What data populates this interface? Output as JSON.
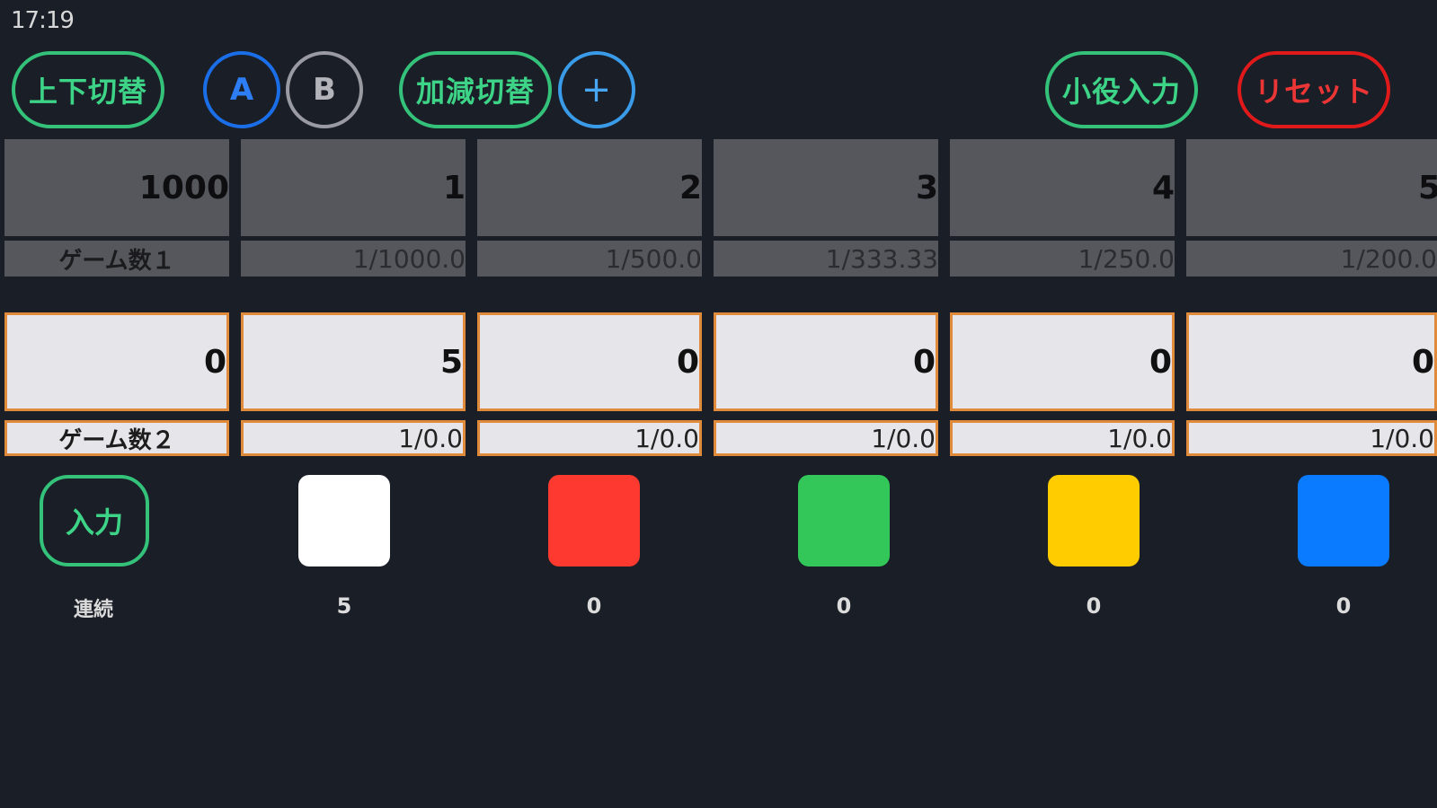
{
  "status_bar": {
    "time": "17:19"
  },
  "toolbar": {
    "swap_label": "上下切替",
    "a_label": "A",
    "b_label": "B",
    "addsub_label": "加減切替",
    "plus_label": "+",
    "small_role_label": "小役入力",
    "reset_label": "リセット"
  },
  "row1": {
    "values": [
      "1000",
      "1",
      "2",
      "3",
      "4",
      "5"
    ],
    "label": "ゲーム数１",
    "probs": [
      "1/1000.0",
      "1/500.0",
      "1/333.33",
      "1/250.0",
      "1/200.0"
    ]
  },
  "row2": {
    "values": [
      "0",
      "5",
      "0",
      "0",
      "0",
      "0"
    ],
    "label": "ゲーム数２",
    "probs": [
      "1/0.0",
      "1/0.0",
      "1/0.0",
      "1/0.0",
      "1/0.0"
    ]
  },
  "input": {
    "label": "入力",
    "sub_label": "連続"
  },
  "swatches": [
    {
      "color": "#ffffff",
      "count": "5"
    },
    {
      "color": "#fe3a30",
      "count": "0"
    },
    {
      "color": "#33c759",
      "count": "0"
    },
    {
      "color": "#ffcc00",
      "count": "0"
    },
    {
      "color": "#0a7aff",
      "count": "0"
    }
  ]
}
